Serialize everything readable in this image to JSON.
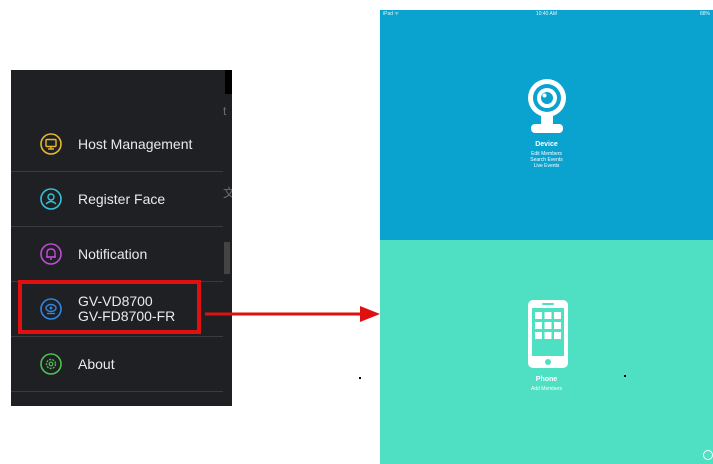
{
  "menu": {
    "peek_text_top": "t",
    "peek_text_mid": "文",
    "items": [
      {
        "label_lines": [
          "Host Management"
        ],
        "icon": "monitor-icon"
      },
      {
        "label_lines": [
          "Register Face"
        ],
        "icon": "person-icon"
      },
      {
        "label_lines": [
          "Notification"
        ],
        "icon": "bell-icon"
      },
      {
        "label_lines": [
          "GV-VD8700",
          "GV-FD8700-FR"
        ],
        "icon": "camera-icon"
      },
      {
        "label_lines": [
          "About"
        ],
        "icon": "gear-icon"
      }
    ]
  },
  "ipad": {
    "status": {
      "carrier": "iPad ᯤ",
      "time": "10:40 AM",
      "battery": "88%"
    },
    "device": {
      "title": "Device",
      "links": [
        "Edit Members",
        "Search Events",
        "Live Events"
      ]
    },
    "phone": {
      "title": "Phone",
      "links": [
        "Add Members"
      ]
    }
  },
  "colors": {
    "menu_bg": "#1f2024",
    "highlight": "#e01010",
    "device_panel": "#0aa3cf",
    "phone_panel": "#4fdfc3",
    "icon_host": "#e6b82f",
    "icon_face": "#35c3d8",
    "icon_notification": "#c04bd6",
    "icon_gv": "#2f86e0",
    "icon_about": "#4cc24c"
  }
}
